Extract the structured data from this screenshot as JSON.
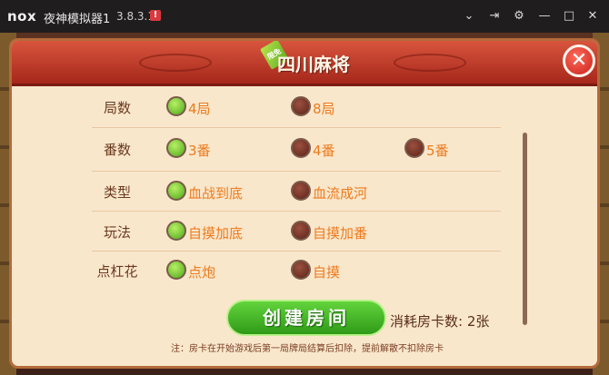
{
  "emulator": {
    "logo": "nox",
    "title": "夜神模拟器1",
    "version": "3.8.3.1",
    "warning_icon": "!",
    "controls": [
      "chevron-down-icon",
      "pin-icon",
      "gear-icon",
      "minimize-icon",
      "maximize-icon",
      "close-icon"
    ]
  },
  "dialog": {
    "badge": "限免",
    "title": "四川麻将",
    "close_icon": "close-icon",
    "rows": [
      {
        "label": "局数",
        "options": [
          {
            "text": "4局",
            "selected": true
          },
          {
            "text": "8局",
            "selected": false
          }
        ]
      },
      {
        "label": "番数",
        "options": [
          {
            "text": "3番",
            "selected": true
          },
          {
            "text": "4番",
            "selected": false
          },
          {
            "text": "5番",
            "selected": false
          }
        ]
      },
      {
        "label": "类型",
        "options": [
          {
            "text": "血战到底",
            "selected": true
          },
          {
            "text": "血流成河",
            "selected": false
          }
        ]
      },
      {
        "label": "玩法",
        "options": [
          {
            "text": "自摸加底",
            "selected": true
          },
          {
            "text": "自摸加番",
            "selected": false
          }
        ]
      },
      {
        "label": "点杠花",
        "options": [
          {
            "text": "点炮",
            "selected": true
          },
          {
            "text": "自摸",
            "selected": false
          }
        ]
      }
    ],
    "create_button": "创建房间",
    "cost": "消耗房卡数: 2张",
    "note": "注：房卡在开始游戏后第一局牌局结算后扣除，提前解散不扣除房卡"
  },
  "colors": {
    "header": "#c23a28",
    "panel": "#f9e7cc",
    "option_text": "#ec7b1e",
    "radio_on": "#5fbd26",
    "radio_off": "#6a2a1c",
    "create_button": "#3aa81f"
  }
}
